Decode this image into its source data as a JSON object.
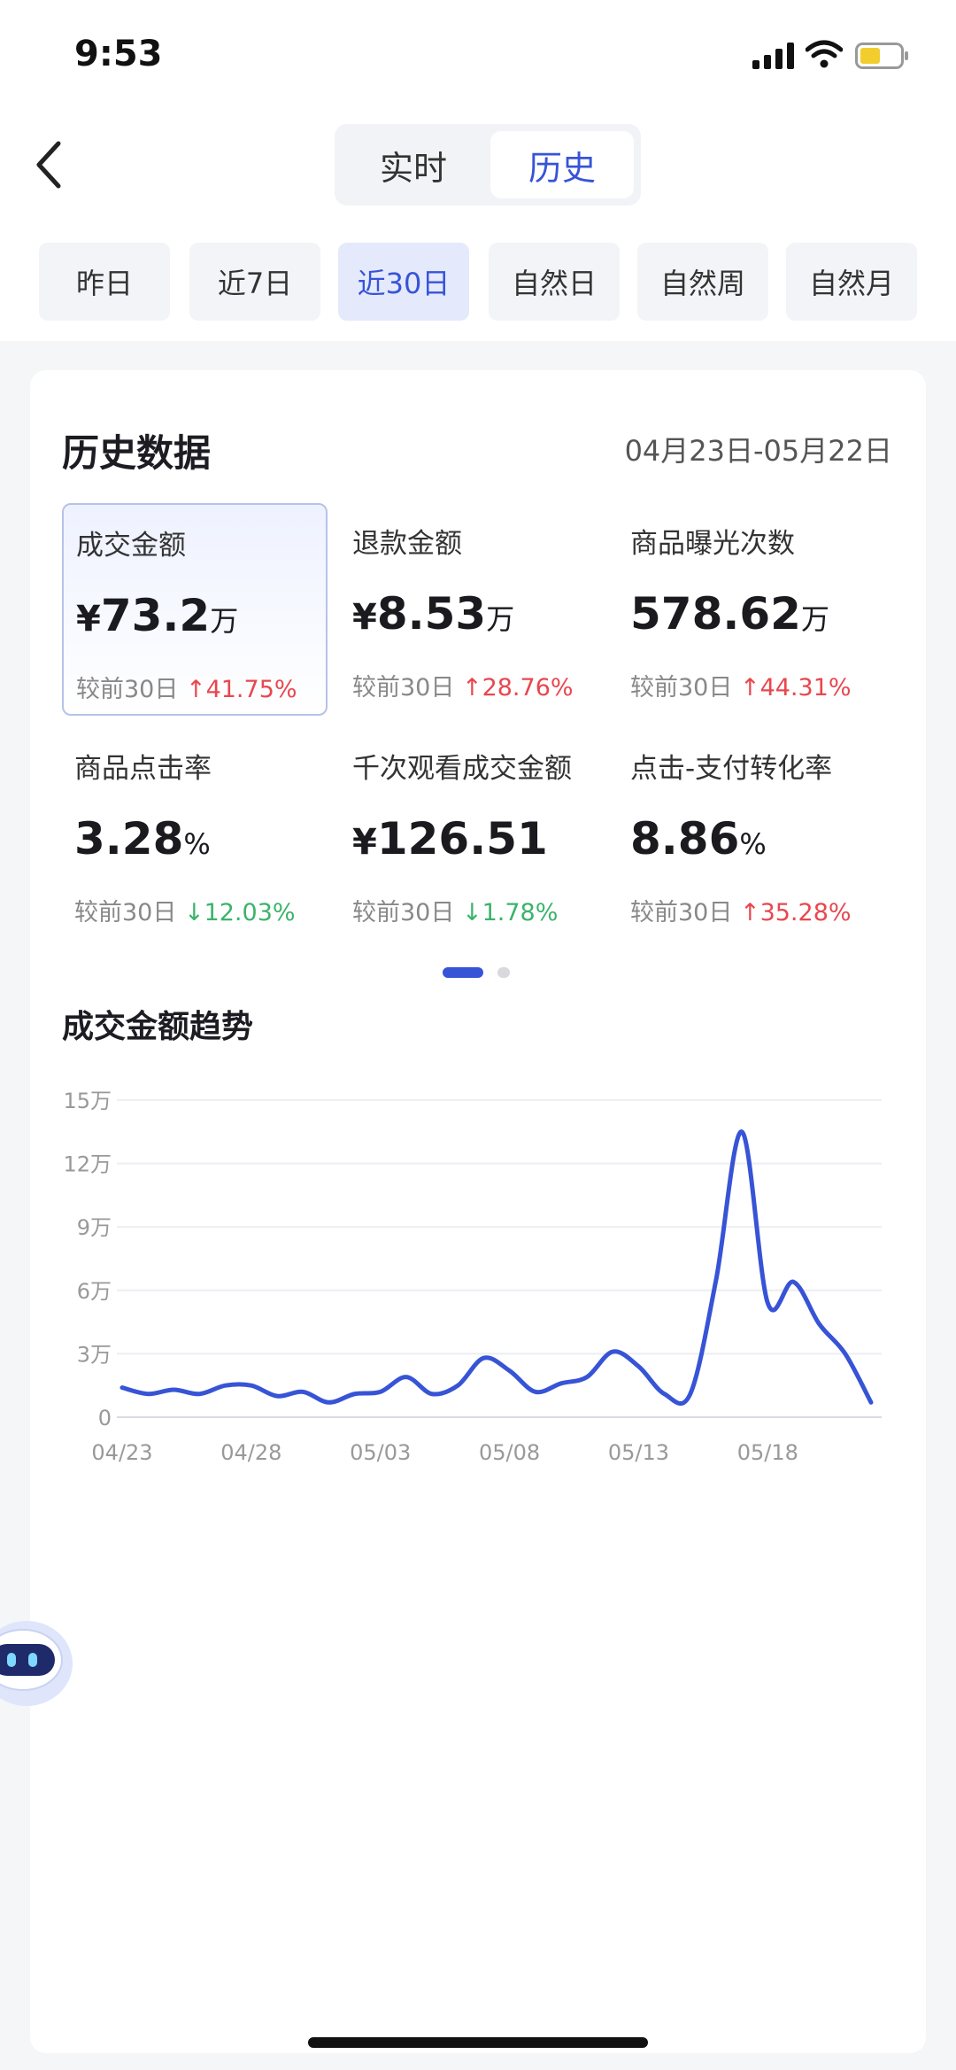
{
  "status_bar": {
    "time": "9:53"
  },
  "header": {
    "tabs": [
      {
        "label": "实时",
        "active": false
      },
      {
        "label": "历史",
        "active": true
      }
    ]
  },
  "filters": [
    {
      "label": "昨日",
      "active": false
    },
    {
      "label": "近7日",
      "active": false
    },
    {
      "label": "近30日",
      "active": true
    },
    {
      "label": "自然日",
      "active": false
    },
    {
      "label": "自然周",
      "active": false
    },
    {
      "label": "自然月",
      "active": false
    }
  ],
  "history": {
    "title": "历史数据",
    "date_range": "04月23日-05月22日",
    "metrics": [
      {
        "label": "成交金额",
        "prefix": "¥",
        "value": "73.2",
        "unit": "万",
        "compare_label": "较前30日",
        "arrow": "↑",
        "change": "41.75%",
        "direction": "up",
        "selected": true
      },
      {
        "label": "退款金额",
        "prefix": "¥",
        "value": "8.53",
        "unit": "万",
        "compare_label": "较前30日",
        "arrow": "↑",
        "change": "28.76%",
        "direction": "up",
        "selected": false
      },
      {
        "label": "商品曝光次数",
        "prefix": "",
        "value": "578.62",
        "unit": "万",
        "compare_label": "较前30日",
        "arrow": "↑",
        "change": "44.31%",
        "direction": "up",
        "selected": false
      },
      {
        "label": "商品点击率",
        "prefix": "",
        "value": "3.28",
        "unit": "%",
        "compare_label": "较前30日",
        "arrow": "↓",
        "change": "12.03%",
        "direction": "down",
        "selected": false
      },
      {
        "label": "千次观看成交金额",
        "prefix": "¥",
        "value": "126.51",
        "unit": "",
        "compare_label": "较前30日",
        "arrow": "↓",
        "change": "1.78%",
        "direction": "down",
        "selected": false
      },
      {
        "label": "点击-支付转化率",
        "prefix": "",
        "value": "8.86",
        "unit": "%",
        "compare_label": "较前30日",
        "arrow": "↑",
        "change": "35.28%",
        "direction": "up",
        "selected": false
      }
    ]
  },
  "trend_title": "成交金额趋势",
  "colors": {
    "accent": "#3754d6",
    "up": "#e8474f",
    "down": "#3bb36b"
  },
  "chart_data": {
    "type": "line",
    "title": "",
    "xlabel": "",
    "ylabel": "",
    "ylim": [
      0,
      15
    ],
    "y_ticks": [
      "0",
      "3万",
      "6万",
      "9万",
      "12万",
      "15万"
    ],
    "y_tick_values": [
      0,
      3,
      6,
      9,
      12,
      15
    ],
    "x_ticks": [
      "04/23",
      "04/28",
      "05/03",
      "05/08",
      "05/13",
      "05/18"
    ],
    "x_tick_index": [
      0,
      5,
      10,
      15,
      20,
      25
    ],
    "grid": true,
    "series": [
      {
        "values": [
          1.4,
          1.1,
          1.3,
          1.1,
          1.5,
          1.5,
          1.0,
          1.2,
          0.7,
          1.1,
          1.2,
          1.9,
          1.1,
          1.5,
          2.8,
          2.2,
          1.2,
          1.6,
          1.9,
          3.1,
          2.4,
          1.1,
          1.1,
          6.5,
          13.5,
          5.4,
          6.4,
          4.4,
          3.0,
          0.7
        ]
      }
    ]
  }
}
